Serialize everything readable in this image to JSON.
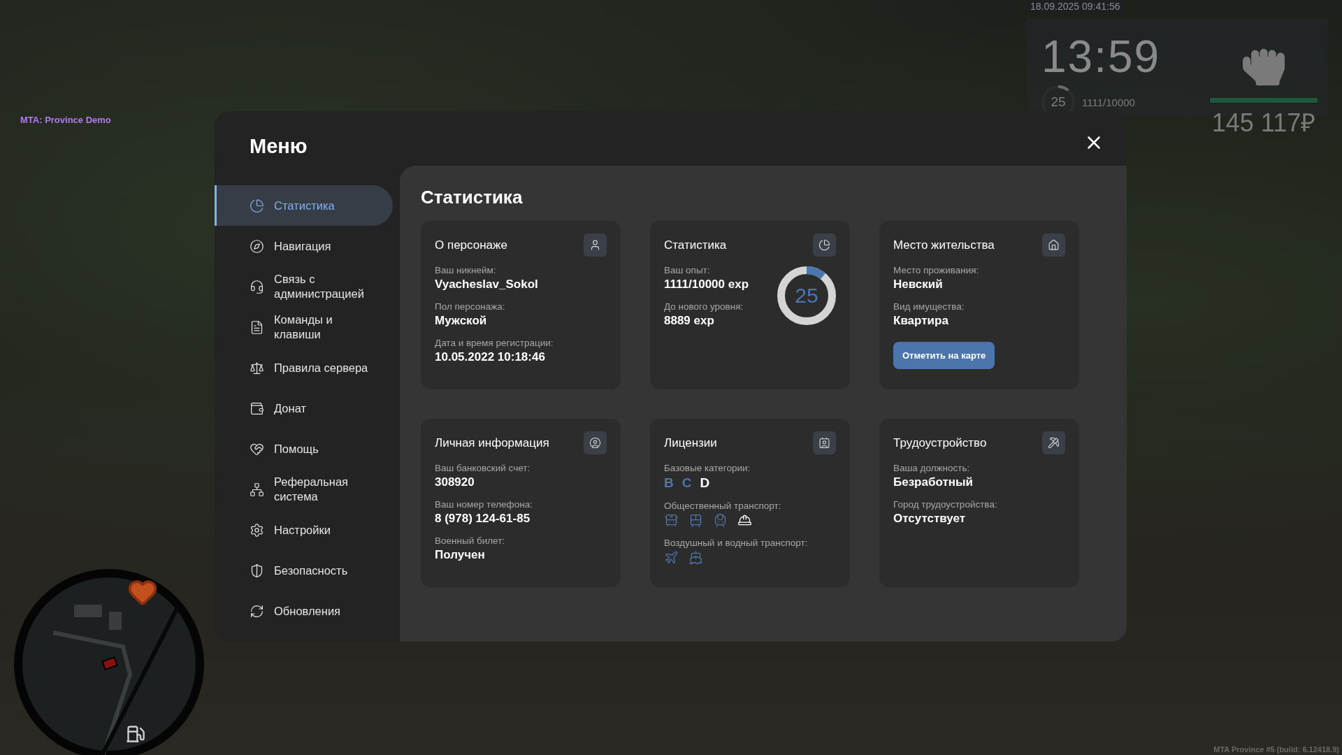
{
  "hud": {
    "datetime": "18.09.2025 09:41:56",
    "clock": "13:59",
    "rank": "25",
    "experience": "1111/10000",
    "exp_ring": {
      "level": 0.111
    },
    "health": {
      "level": 1
    },
    "money": "145 117₽"
  },
  "server_label": "MTA: Province Demo",
  "build": "MTA Province #5 (build: 6.12418.9)",
  "menu": {
    "title": "Меню",
    "sidebar": {
      "items": [
        {
          "label": "Статистика",
          "selected": true
        },
        {
          "label": "Навигация",
          "selected": false
        },
        {
          "label": "Связь с администрацией",
          "selected": false
        },
        {
          "label": "Команды и клавиши",
          "selected": false
        },
        {
          "label": "Правила сервера",
          "selected": false
        },
        {
          "label": "Донат",
          "selected": false
        },
        {
          "label": "Помощь",
          "selected": false
        },
        {
          "label": "Реферальная система",
          "selected": false
        },
        {
          "label": "Настройки",
          "selected": false
        },
        {
          "label": "Безопасность",
          "selected": false
        },
        {
          "label": "Обновления",
          "selected": false
        }
      ]
    }
  },
  "page": {
    "title": "Статистика",
    "cards": [
      {
        "kind": "info",
        "title": "О персонаже",
        "fields": [
          {
            "label": "Ваш никнейм:",
            "value": "Vyacheslav_Sokol"
          },
          {
            "label": "Пол персонажа:",
            "value": "Мужской"
          },
          {
            "label": "Дата и время регистрации:",
            "value": "10.05.2022 10:18:46"
          }
        ]
      },
      {
        "kind": "progress",
        "title": "Статистика",
        "fields": [
          {
            "label": "Ваш опыт:",
            "value": "1111/10000 exp"
          },
          {
            "label": "До нового уровня:",
            "value": "8889 exp"
          }
        ],
        "ring": {
          "label": "25",
          "level": 0.111
        }
      },
      {
        "kind": "info",
        "title": "Место жительства",
        "fields": [
          {
            "label": "Место проживания:",
            "value": "Невский"
          },
          {
            "label": "Вид имущества:",
            "value": "Квартира"
          }
        ],
        "button": "Отметить на карте"
      },
      {
        "kind": "info",
        "title": "Личная информация",
        "fields": [
          {
            "label": "Ваш банковский счет:",
            "value": "308920"
          },
          {
            "label": "Ваш номер телефона:",
            "value": "8 (978) 124-61-85"
          },
          {
            "label": "Военный билет:",
            "value": "Получен"
          }
        ]
      },
      {
        "kind": "licenses",
        "title": "Лицензии",
        "groups": [
          {
            "kind": "letters",
            "label": "Базовые категории:",
            "items": [
              {
                "text": "B",
                "obtained": true
              },
              {
                "text": "C",
                "obtained": true
              },
              {
                "text": "D",
                "obtained": false
              }
            ]
          },
          {
            "kind": "icons",
            "label": "Общественный транспорт:",
            "items": [
              {
                "obtained": true
              },
              {
                "obtained": true
              },
              {
                "obtained": true
              },
              {
                "obtained": false
              }
            ]
          },
          {
            "kind": "icons",
            "label": "Воздушный и водный транспорт:",
            "items": [
              {
                "obtained": true
              },
              {
                "obtained": true
              }
            ]
          }
        ]
      },
      {
        "kind": "info",
        "title": "Трудоустройство",
        "fields": [
          {
            "label": "Ваша должность:",
            "value": "Безработный"
          },
          {
            "label": "Город трудоустройства:",
            "value": "Отсутствует"
          }
        ]
      }
    ]
  }
}
